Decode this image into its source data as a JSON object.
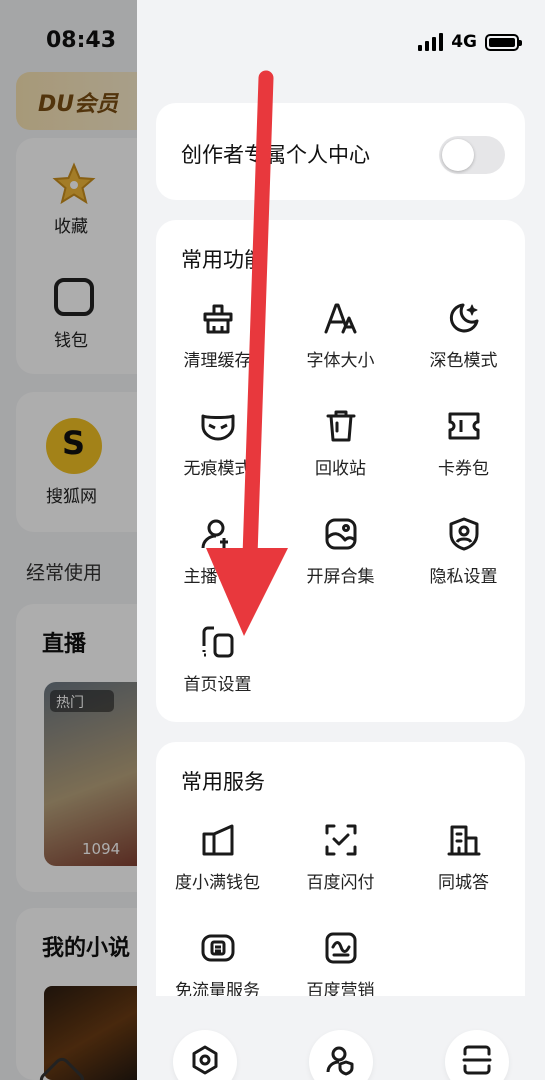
{
  "status_bar": {
    "time": "08:43",
    "network": "4G"
  },
  "background_page": {
    "vip_label": "DU会员",
    "shortcuts": [
      {
        "label": "收藏",
        "icon": "star-icon"
      },
      {
        "label": "钱包",
        "icon": "wallet-icon"
      }
    ],
    "app_entry": {
      "label": "搜狐网",
      "icon": "sohu-logo-icon"
    },
    "section_title": "经常使用",
    "live_title": "直播",
    "live_badge": "热门",
    "live_viewers": "1094",
    "novel_title": "我的小说"
  },
  "drawer": {
    "creator": {
      "label": "创作者专属个人中心",
      "toggle_on": false
    },
    "common_functions": {
      "title": "常用功能",
      "items": [
        {
          "label": "清理缓存",
          "icon": "broom-icon"
        },
        {
          "label": "字体大小",
          "icon": "font-size-icon"
        },
        {
          "label": "深色模式",
          "icon": "moon-icon"
        },
        {
          "label": "无痕模式",
          "icon": "mask-icon"
        },
        {
          "label": "回收站",
          "icon": "trash-icon"
        },
        {
          "label": "卡券包",
          "icon": "ticket-icon"
        },
        {
          "label": "主播中心",
          "icon": "anchor-icon"
        },
        {
          "label": "开屏合集",
          "icon": "image-icon"
        },
        {
          "label": "隐私设置",
          "icon": "privacy-shield-icon"
        },
        {
          "label": "首页设置",
          "icon": "homepage-settings-icon"
        }
      ]
    },
    "common_services": {
      "title": "常用服务",
      "items": [
        {
          "label": "度小满钱包",
          "icon": "wallet-book-icon"
        },
        {
          "label": "百度闪付",
          "icon": "scan-pay-icon"
        },
        {
          "label": "同城答",
          "icon": "building-icon"
        },
        {
          "label": "免流量服务",
          "icon": "data-free-icon"
        },
        {
          "label": "百度营销",
          "icon": "marketing-icon"
        }
      ]
    },
    "bottom_buttons": [
      {
        "icon": "settings-icon"
      },
      {
        "icon": "account-security-icon"
      },
      {
        "icon": "scan-icon"
      }
    ]
  },
  "colors": {
    "arrow": "#e8383d",
    "drawer_bg": "#f2f3f5",
    "card_bg": "#ffffff"
  }
}
